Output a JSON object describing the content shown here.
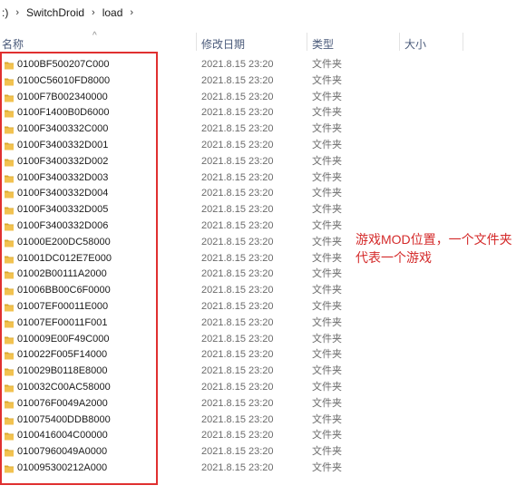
{
  "breadcrumb": {
    "items": [
      ":)",
      "SwitchDroid",
      "load"
    ],
    "separator": "›"
  },
  "columns": {
    "name": "名称",
    "date": "修改日期",
    "type": "类型",
    "size": "大小"
  },
  "sort_indicator": "^",
  "files": [
    {
      "name": "0100BF500207C000",
      "date": "2021.8.15 23:20",
      "type": "文件夹"
    },
    {
      "name": "0100C56010FD8000",
      "date": "2021.8.15 23:20",
      "type": "文件夹"
    },
    {
      "name": "0100F7B002340000",
      "date": "2021.8.15 23:20",
      "type": "文件夹"
    },
    {
      "name": "0100F1400B0D6000",
      "date": "2021.8.15 23:20",
      "type": "文件夹"
    },
    {
      "name": "0100F3400332C000",
      "date": "2021.8.15 23:20",
      "type": "文件夹"
    },
    {
      "name": "0100F3400332D001",
      "date": "2021.8.15 23:20",
      "type": "文件夹"
    },
    {
      "name": "0100F3400332D002",
      "date": "2021.8.15 23:20",
      "type": "文件夹"
    },
    {
      "name": "0100F3400332D003",
      "date": "2021.8.15 23:20",
      "type": "文件夹"
    },
    {
      "name": "0100F3400332D004",
      "date": "2021.8.15 23:20",
      "type": "文件夹"
    },
    {
      "name": "0100F3400332D005",
      "date": "2021.8.15 23:20",
      "type": "文件夹"
    },
    {
      "name": "0100F3400332D006",
      "date": "2021.8.15 23:20",
      "type": "文件夹"
    },
    {
      "name": "01000E200DC58000",
      "date": "2021.8.15 23:20",
      "type": "文件夹"
    },
    {
      "name": "01001DC012E7E000",
      "date": "2021.8.15 23:20",
      "type": "文件夹"
    },
    {
      "name": "01002B00111A2000",
      "date": "2021.8.15 23:20",
      "type": "文件夹"
    },
    {
      "name": "01006BB00C6F0000",
      "date": "2021.8.15 23:20",
      "type": "文件夹"
    },
    {
      "name": "01007EF00011E000",
      "date": "2021.8.15 23:20",
      "type": "文件夹"
    },
    {
      "name": "01007EF00011F001",
      "date": "2021.8.15 23:20",
      "type": "文件夹"
    },
    {
      "name": "010009E00F49C000",
      "date": "2021.8.15 23:20",
      "type": "文件夹"
    },
    {
      "name": "010022F005F14000",
      "date": "2021.8.15 23:20",
      "type": "文件夹"
    },
    {
      "name": "010029B0118E8000",
      "date": "2021.8.15 23:20",
      "type": "文件夹"
    },
    {
      "name": "010032C00AC58000",
      "date": "2021.8.15 23:20",
      "type": "文件夹"
    },
    {
      "name": "010076F0049A2000",
      "date": "2021.8.15 23:20",
      "type": "文件夹"
    },
    {
      "name": "010075400DDB8000",
      "date": "2021.8.15 23:20",
      "type": "文件夹"
    },
    {
      "name": "0100416004C00000",
      "date": "2021.8.15 23:20",
      "type": "文件夹"
    },
    {
      "name": "01007960049A0000",
      "date": "2021.8.15 23:20",
      "type": "文件夹"
    },
    {
      "name": "010095300212A000",
      "date": "2021.8.15 23:20",
      "type": "文件夹"
    }
  ],
  "annotation": {
    "line1": "游戏MOD位置，一个文件夹",
    "line2": "代表一个游戏"
  },
  "colors": {
    "folder": "#f2c250",
    "folder_dark": "#d9a72c",
    "highlight": "#e03030",
    "annotation": "#d42a2a"
  },
  "icons": {
    "folder": "folder-icon",
    "breadcrumb_separator": "chevron-right-icon"
  }
}
